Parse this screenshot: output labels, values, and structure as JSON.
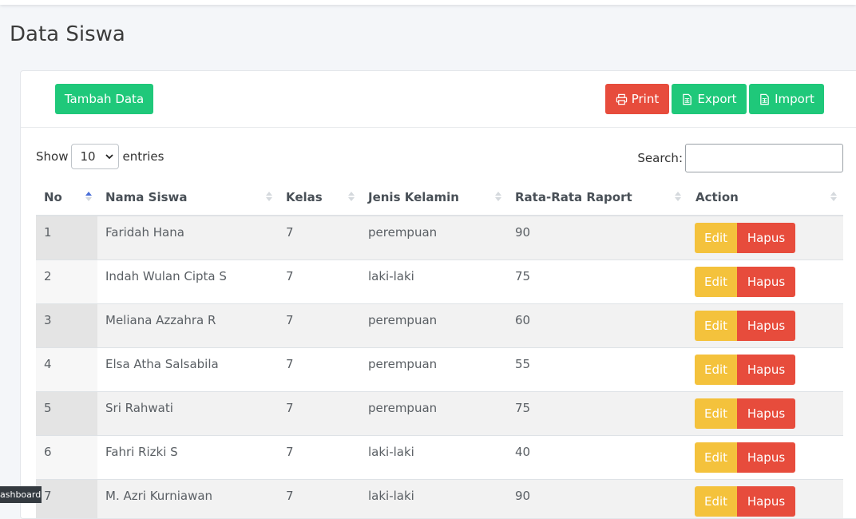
{
  "page": {
    "title": "Data Siswa"
  },
  "toolbar": {
    "add_label": "Tambah Data",
    "print_label": "Print",
    "export_label": "Export",
    "import_label": "Import"
  },
  "length": {
    "show_label": "Show",
    "selected": "10",
    "entries_label": "entries"
  },
  "search": {
    "label": "Search:",
    "value": ""
  },
  "table": {
    "columns": [
      "No",
      "Nama Siswa",
      "Kelas",
      "Jenis Kelamin",
      "Rata-Rata Raport",
      "Action"
    ],
    "sorted_column": "No",
    "rows": [
      {
        "no": "1",
        "nama": "Faridah Hana",
        "kelas": "7",
        "jk": "perempuan",
        "rata": "90"
      },
      {
        "no": "2",
        "nama": "Indah Wulan Cipta S",
        "kelas": "7",
        "jk": "laki-laki",
        "rata": "75"
      },
      {
        "no": "3",
        "nama": "Meliana Azzahra R",
        "kelas": "7",
        "jk": "perempuan",
        "rata": "60"
      },
      {
        "no": "4",
        "nama": "Elsa Atha Salsabila",
        "kelas": "7",
        "jk": "perempuan",
        "rata": "55"
      },
      {
        "no": "5",
        "nama": "Sri Rahwati",
        "kelas": "7",
        "jk": "perempuan",
        "rata": "75"
      },
      {
        "no": "6",
        "nama": "Fahri Rizki S",
        "kelas": "7",
        "jk": "laki-laki",
        "rata": "40"
      },
      {
        "no": "7",
        "nama": "M. Azri Kurniawan",
        "kelas": "7",
        "jk": "laki-laki",
        "rata": "90"
      }
    ],
    "edit_label": "Edit",
    "delete_label": "Hapus"
  },
  "footer_tag": "ashboard",
  "colors": {
    "green": "#1fc87a",
    "red": "#e74c3c",
    "yellow": "#f4c23c"
  }
}
